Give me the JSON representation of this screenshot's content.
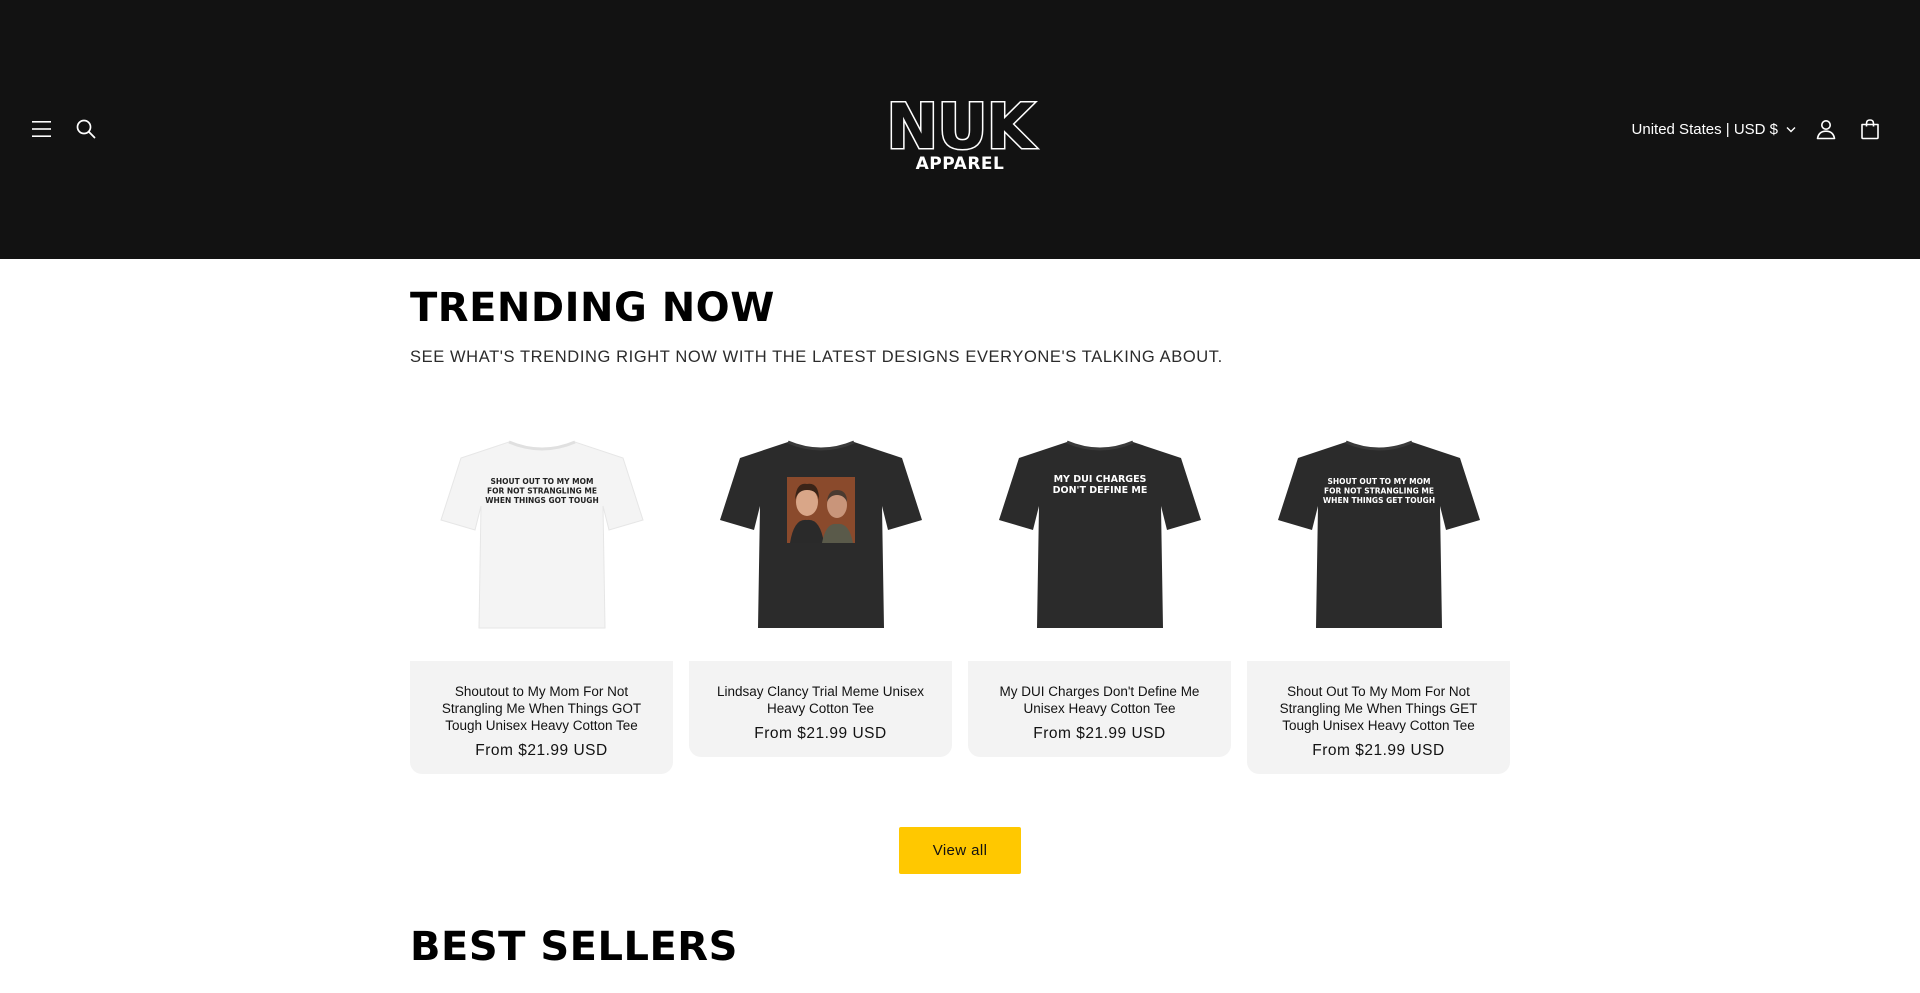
{
  "header": {
    "logo_text": "NUK",
    "logo_subtext": "APPAREL",
    "localization_label": "United States | USD $"
  },
  "trending": {
    "title": "TRENDING NOW",
    "subtitle": "SEE WHAT'S TRENDING RIGHT NOW WITH THE LATEST DESIGNS EVERYONE'S TALKING ABOUT.",
    "products": [
      {
        "title": "Shoutout to My Mom For Not Strangling Me When Things GOT Tough Unisex Heavy Cotton Tee",
        "price": "From $21.99 USD",
        "shirt_color": "#f4f4f4",
        "print_lines": [
          "SHOUT OUT TO MY MOM",
          "FOR NOT STRANGLING ME",
          "WHEN THINGS GOT TOUGH"
        ],
        "print_color": "#222222"
      },
      {
        "title": "Lindsay Clancy Trial Meme Unisex Heavy Cotton Tee",
        "price": "From $21.99 USD",
        "shirt_color": "#2b2b2b",
        "print_lines": [],
        "print_color": "#ffffff"
      },
      {
        "title": "My DUI Charges Don't Define Me Unisex Heavy Cotton Tee",
        "price": "From $21.99 USD",
        "shirt_color": "#2b2b2b",
        "print_lines": [
          "MY DUI CHARGES",
          "DON'T DEFINE ME"
        ],
        "print_color": "#ffffff"
      },
      {
        "title": "Shout Out To My Mom For Not Strangling Me When Things GET Tough Unisex Heavy Cotton Tee",
        "price": "From $21.99 USD",
        "shirt_color": "#2b2b2b",
        "print_lines": [
          "SHOUT OUT TO MY MOM",
          "FOR NOT STRANGLING ME",
          "WHEN THINGS GET TOUGH"
        ],
        "print_color": "#ffffff"
      }
    ],
    "view_all_label": "View all"
  },
  "best_sellers": {
    "title": "BEST SELLERS"
  },
  "colors": {
    "header_bg": "#121212",
    "card_info_bg": "#f3f3f3",
    "button_bg": "#ffc800"
  },
  "icons": [
    "menu-icon",
    "search-icon",
    "chevron-down-icon",
    "account-icon",
    "cart-icon"
  ]
}
